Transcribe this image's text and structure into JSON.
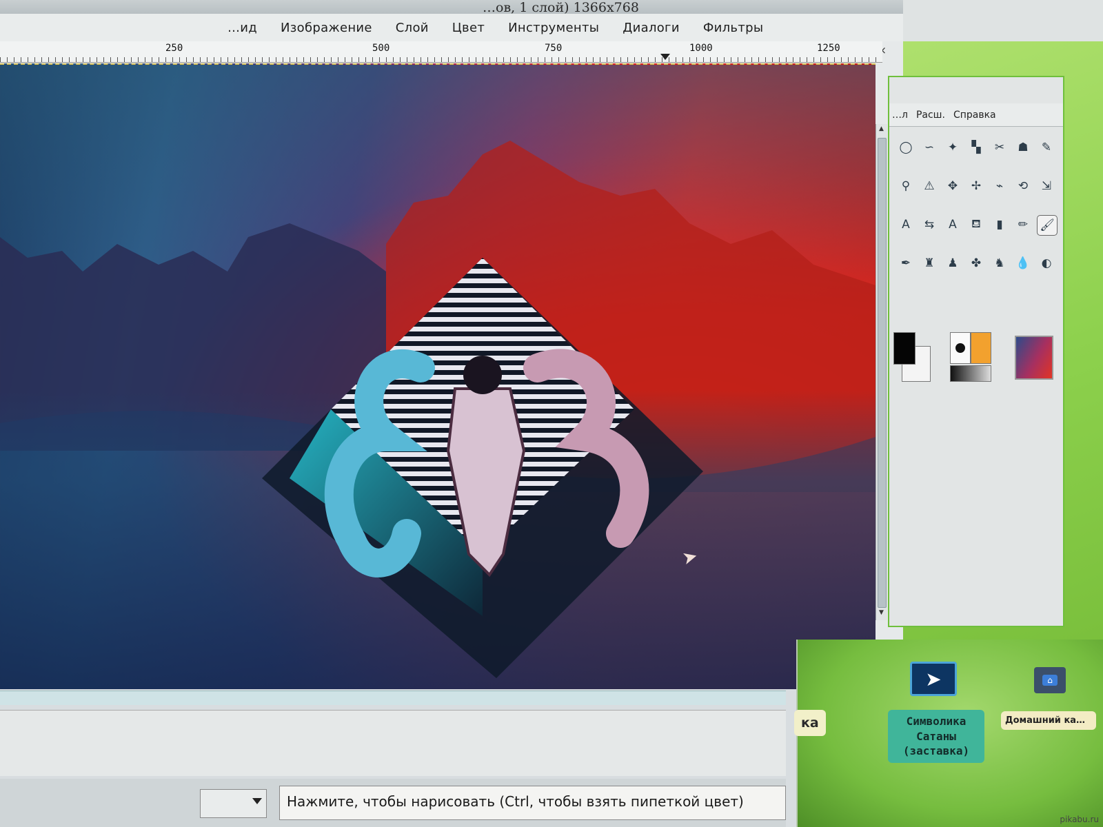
{
  "window": {
    "title": "…ов, 1 слой) 1366x768",
    "controls": [
      "↑",
      "−",
      "□",
      "×"
    ]
  },
  "menu": {
    "items": [
      "…ид",
      "Изображение",
      "Слой",
      "Цвет",
      "Инструменты",
      "Диалоги",
      "Фильтры"
    ]
  },
  "ruler": {
    "labels": [
      "250",
      "500",
      "750",
      "1000",
      "1250"
    ]
  },
  "status": {
    "units": "",
    "message": "Нажмите, чтобы нарисовать (Ctrl, чтобы взять пипеткой цвет)"
  },
  "toolbox": {
    "menu": [
      "…л",
      "Расш.",
      "Справка"
    ],
    "tools": [
      {
        "icon": "ellipse-select-icon",
        "glyph": "◯"
      },
      {
        "icon": "free-select-icon",
        "glyph": "∽"
      },
      {
        "icon": "fuzzy-select-icon",
        "glyph": "✦"
      },
      {
        "icon": "color-select-icon",
        "glyph": "▚"
      },
      {
        "icon": "scissors-select-icon",
        "glyph": "✂"
      },
      {
        "icon": "foreground-select-icon",
        "glyph": "☗"
      },
      {
        "icon": "paths-icon",
        "glyph": "✎"
      },
      {
        "icon": "zoom-icon",
        "glyph": "⚲"
      },
      {
        "icon": "measure-icon",
        "glyph": "⚠"
      },
      {
        "icon": "move-icon",
        "glyph": "✥"
      },
      {
        "icon": "align-icon",
        "glyph": "✢"
      },
      {
        "icon": "crop-icon",
        "glyph": "⌁"
      },
      {
        "icon": "rotate-icon",
        "glyph": "⟲"
      },
      {
        "icon": "scale-icon",
        "glyph": "⇲"
      },
      {
        "icon": "text-icon",
        "glyph": "A"
      },
      {
        "icon": "flip-icon",
        "glyph": "⇆"
      },
      {
        "icon": "text-alt-icon",
        "glyph": "A"
      },
      {
        "icon": "bucket-fill-icon",
        "glyph": "⛾"
      },
      {
        "icon": "blend-icon",
        "glyph": "▮"
      },
      {
        "icon": "pencil-icon",
        "glyph": "✏"
      },
      {
        "icon": "paintbrush-icon",
        "glyph": "🖌"
      },
      {
        "icon": "airbrush-icon",
        "glyph": "✒"
      },
      {
        "icon": "ink-icon",
        "glyph": "♜"
      },
      {
        "icon": "clone-icon",
        "glyph": "♟"
      },
      {
        "icon": "heal-icon",
        "glyph": "✤"
      },
      {
        "icon": "perspective-clone-icon",
        "glyph": "♞"
      },
      {
        "icon": "smudge-icon",
        "glyph": "💧"
      },
      {
        "icon": "dodge-burn-icon",
        "glyph": "◐"
      }
    ],
    "active_tool_index": 20
  },
  "colors": {
    "foreground": "#050505",
    "background": "#f4f4f4",
    "desktop_green": "#8cd04c",
    "selection_marching_ants": "#d9c35a"
  },
  "desktop": {
    "partial_label": "ка",
    "icons": [
      {
        "name": "Символика Сатаны (заставка)",
        "icon": "cursor-screenshot-icon"
      },
      {
        "name": "Домашний ка…",
        "icon": "home-folder-icon"
      }
    ],
    "icon_label_lines": [
      "Символика",
      "Сатаны",
      "(заставка)"
    ]
  },
  "watermark": "pikabu.ru"
}
